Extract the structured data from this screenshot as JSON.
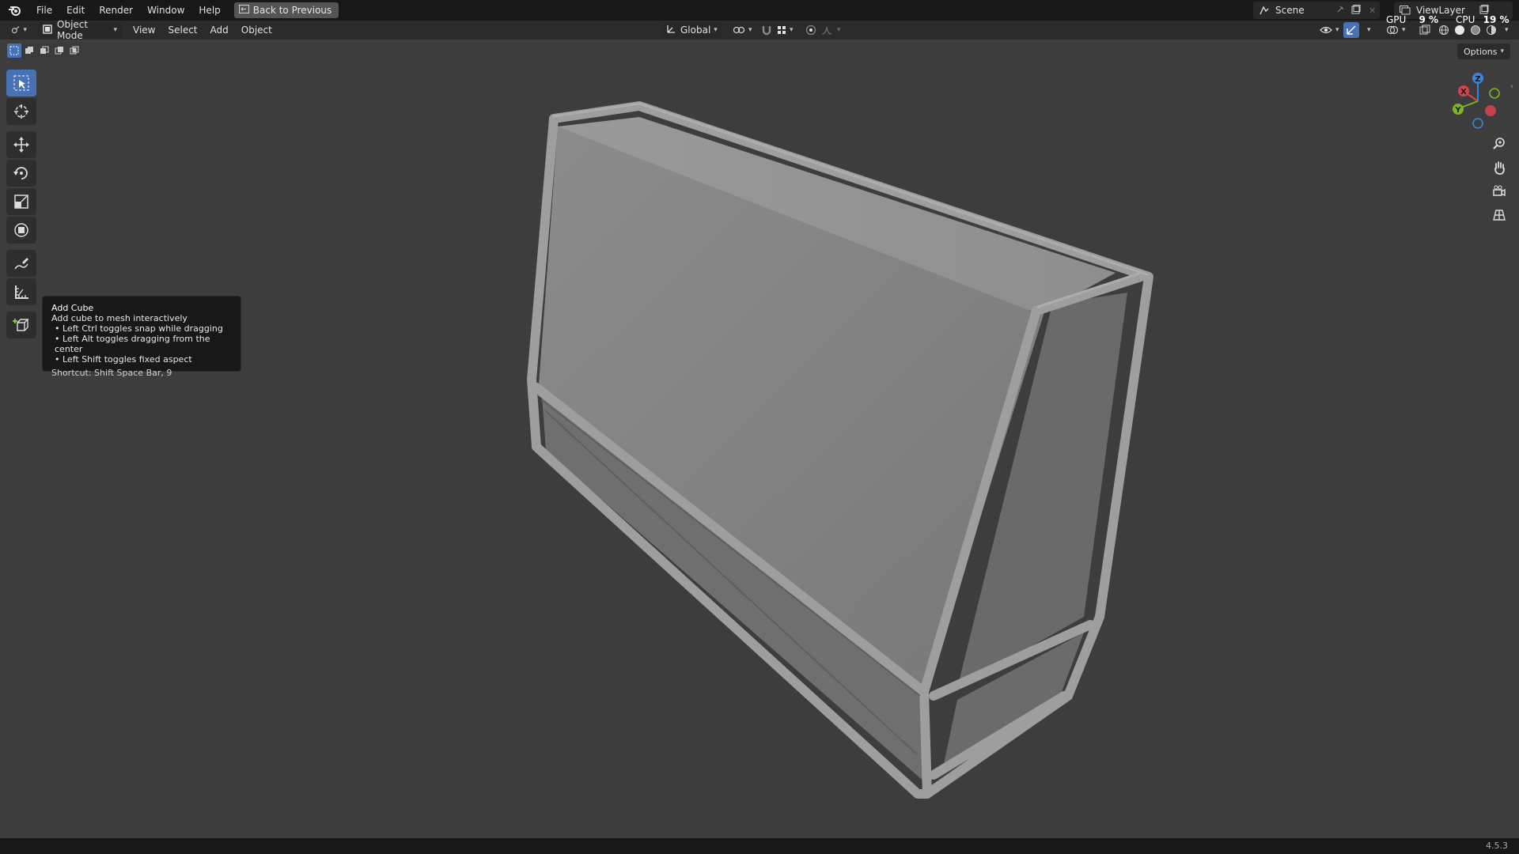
{
  "topbar": {
    "menu": [
      "File",
      "Edit",
      "Render",
      "Window",
      "Help"
    ],
    "back_label": "Back to Previous",
    "scene_name": "Scene",
    "view_layer": "ViewLayer",
    "gpu_label": "GPU",
    "gpu_value": "9 %",
    "cpu_label": "CPU",
    "cpu_value": "19 %"
  },
  "header": {
    "mode": "Object Mode",
    "menu": [
      "View",
      "Select",
      "Add",
      "Object"
    ],
    "orientation": "Global"
  },
  "viewport": {
    "options_label": "Options",
    "gizmo": {
      "x": "X",
      "y": "Y",
      "z": "Z"
    }
  },
  "tooltip": {
    "title": "Add Cube",
    "description": "Add cube to mesh interactively",
    "bullets": [
      "Left Ctrl toggles snap while dragging",
      "Left Alt toggles dragging from the center",
      "Left Shift toggles fixed aspect"
    ],
    "shortcut": "Shortcut: Shift Space Bar, 9"
  },
  "statusbar": {
    "version": "4.5.3"
  },
  "colors": {
    "accent": "#4772b3",
    "axis_x": "#d9434b",
    "axis_y": "#7fb224",
    "axis_z": "#3a84d9"
  }
}
